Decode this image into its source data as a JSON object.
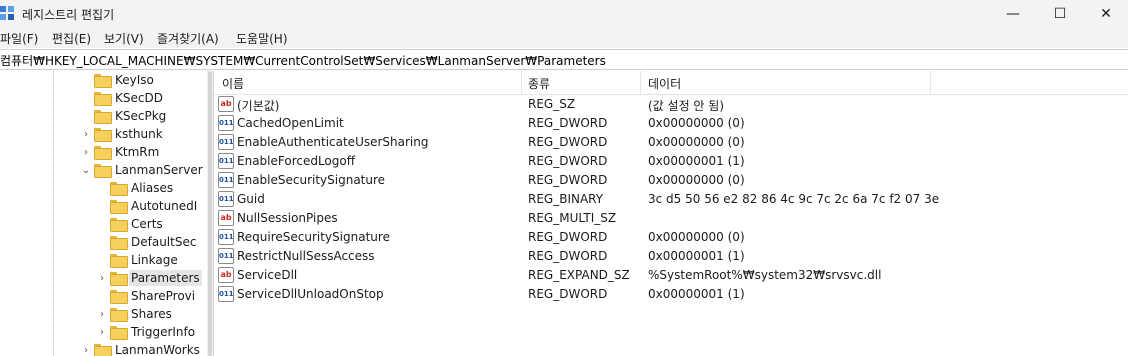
{
  "window": {
    "title": "레지스트리 편집기",
    "buttons": {
      "minimize": "—",
      "maximize": "☐",
      "close": "✕"
    }
  },
  "menu": [
    "파일(F)",
    "편집(E)",
    "보기(V)",
    "즐겨찾기(A)",
    "도움말(H)"
  ],
  "address": "컴퓨터₩HKEY_LOCAL_MACHINE₩SYSTEM₩CurrentControlSet₩Services₩LanmanServer₩Parameters",
  "tree": {
    "items": [
      {
        "label": "KeyIso",
        "expander": ""
      },
      {
        "label": "KSecDD",
        "expander": ""
      },
      {
        "label": "KSecPkg",
        "expander": ""
      },
      {
        "label": "ksthunk",
        "expander": "›"
      },
      {
        "label": "KtmRm",
        "expander": "›"
      },
      {
        "label": "LanmanServer",
        "expander": "⌄"
      },
      {
        "label": "Aliases",
        "expander": ""
      },
      {
        "label": "AutotunedI",
        "expander": ""
      },
      {
        "label": "Certs",
        "expander": ""
      },
      {
        "label": "DefaultSec",
        "expander": ""
      },
      {
        "label": "Linkage",
        "expander": ""
      },
      {
        "label": "Parameters",
        "expander": "›",
        "selected": true
      },
      {
        "label": "ShareProvi",
        "expander": ""
      },
      {
        "label": "Shares",
        "expander": "›"
      },
      {
        "label": "TriggerInfo",
        "expander": "›"
      },
      {
        "label": "LanmanWorks",
        "expander": "›"
      }
    ]
  },
  "columns": {
    "name": "이름",
    "type": "종류",
    "data": "데이터"
  },
  "values": [
    {
      "icon": "string-value-icon",
      "icon_text": "ab",
      "name": "(기본값)",
      "type": "REG_SZ",
      "data": "(값 설정 안 됨)"
    },
    {
      "icon": "binary-value-icon",
      "icon_text": "011",
      "name": "CachedOpenLimit",
      "type": "REG_DWORD",
      "data": "0x00000000 (0)"
    },
    {
      "icon": "binary-value-icon",
      "icon_text": "011",
      "name": "EnableAuthenticateUserSharing",
      "type": "REG_DWORD",
      "data": "0x00000000 (0)"
    },
    {
      "icon": "binary-value-icon",
      "icon_text": "011",
      "name": "EnableForcedLogoff",
      "type": "REG_DWORD",
      "data": "0x00000001 (1)"
    },
    {
      "icon": "binary-value-icon",
      "icon_text": "011",
      "name": "EnableSecuritySignature",
      "type": "REG_DWORD",
      "data": "0x00000000 (0)"
    },
    {
      "icon": "binary-value-icon",
      "icon_text": "011",
      "name": "Guid",
      "type": "REG_BINARY",
      "data": "3c d5 50 56 e2 82 86 4c 9c 7c 2c 6a 7c f2 07 3e"
    },
    {
      "icon": "string-value-icon",
      "icon_text": "ab",
      "name": "NullSessionPipes",
      "type": "REG_MULTI_SZ",
      "data": ""
    },
    {
      "icon": "binary-value-icon",
      "icon_text": "011",
      "name": "RequireSecuritySignature",
      "type": "REG_DWORD",
      "data": "0x00000000 (0)"
    },
    {
      "icon": "binary-value-icon",
      "icon_text": "011",
      "name": "RestrictNullSessAccess",
      "type": "REG_DWORD",
      "data": "0x00000001 (1)"
    },
    {
      "icon": "string-value-icon",
      "icon_text": "ab",
      "name": "ServiceDll",
      "type": "REG_EXPAND_SZ",
      "data": "%SystemRoot%₩system32₩srvsvc.dll"
    },
    {
      "icon": "binary-value-icon",
      "icon_text": "011",
      "name": "ServiceDllUnloadOnStop",
      "type": "REG_DWORD",
      "data": "0x00000001 (1)"
    }
  ]
}
